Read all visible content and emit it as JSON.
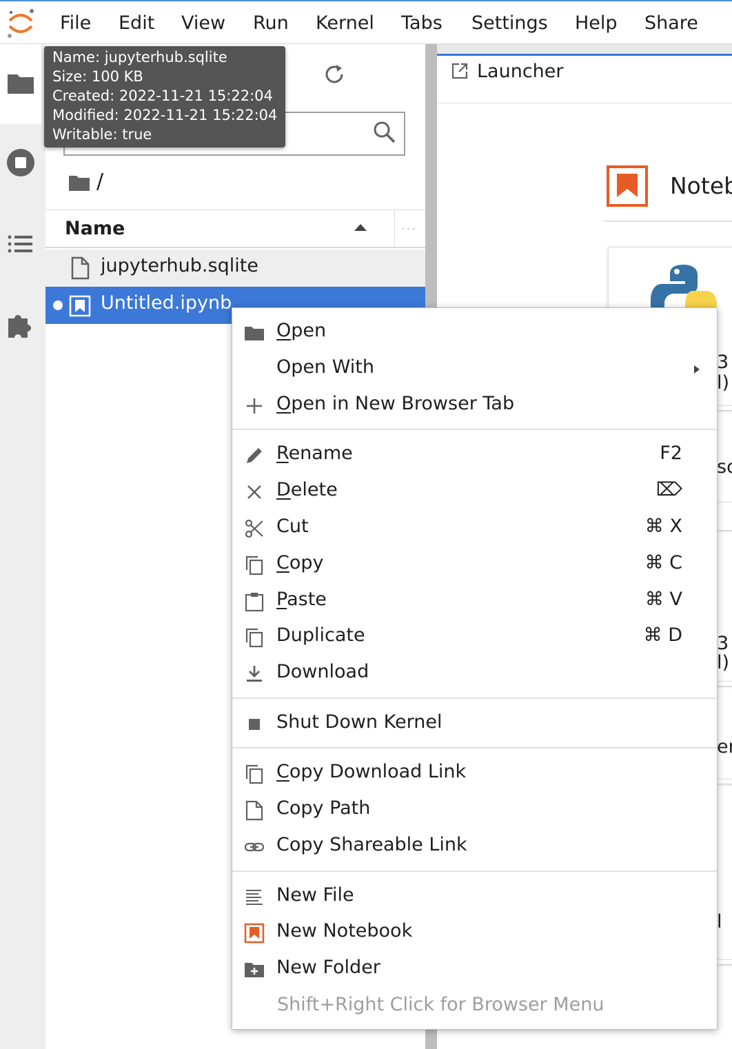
{
  "menubar": {
    "items": [
      "File",
      "Edit",
      "View",
      "Run",
      "Kernel",
      "Tabs",
      "Settings",
      "Help",
      "Share"
    ]
  },
  "filebrowser": {
    "breadcrumb": "/",
    "column_name": "Name",
    "files": [
      {
        "name": "jupyterhub.sqlite",
        "type": "file"
      },
      {
        "name": "Untitled.ipynb",
        "type": "notebook",
        "selected": true,
        "running": true
      }
    ]
  },
  "tooltip": {
    "lines": [
      "Name: jupyterhub.sqlite",
      "Size: 100 KB",
      "Created: 2022-11-21 15:22:04",
      "Modified: 2022-11-21 15:22:04",
      "Writable: true"
    ]
  },
  "launcher": {
    "tab_label": "Launcher",
    "notebook_section_title": "Noteb"
  },
  "context_menu": {
    "items": [
      {
        "first": "O",
        "rest": "pen",
        "icon": "folder-icon"
      },
      {
        "label": "Open With",
        "submenu": true
      },
      {
        "first": "O",
        "rest": "pen in New Browser Tab",
        "icon": "plus-icon"
      },
      {
        "first": "R",
        "rest": "ename",
        "shortcut": "F2",
        "icon": "pencil-icon"
      },
      {
        "first": "D",
        "rest": "elete",
        "shortcut": "⌦",
        "icon": "close-icon"
      },
      {
        "label": "Cut",
        "shortcut": "⌘ X",
        "icon": "scissors-icon"
      },
      {
        "first": "C",
        "rest": "opy",
        "shortcut": "⌘ C",
        "icon": "copy-icon"
      },
      {
        "first": "P",
        "rest": "aste",
        "shortcut": "⌘ V",
        "icon": "paste-icon"
      },
      {
        "label": "Duplicate",
        "shortcut": "⌘ D",
        "icon": "duplicate-icon"
      },
      {
        "label": "Download",
        "icon": "download-icon"
      },
      {
        "label": "Shut Down Kernel",
        "icon": "stop-icon"
      },
      {
        "first": "C",
        "rest": "opy Download Link",
        "icon": "copy-icon"
      },
      {
        "label": "Copy Path",
        "icon": "file-icon"
      },
      {
        "label": "Copy Shareable Link",
        "icon": "link-icon"
      },
      {
        "label": "New File",
        "icon": "text-file-icon"
      },
      {
        "label": "New Notebook",
        "icon": "notebook-icon"
      },
      {
        "label": "New Folder",
        "icon": "new-folder-icon"
      }
    ],
    "hint": "Shift+Right Click for Browser Menu"
  },
  "colors": {
    "selection": "#3c78d8",
    "notebook_orange": "#e65c26",
    "jupyter_orange": "#f37726"
  }
}
